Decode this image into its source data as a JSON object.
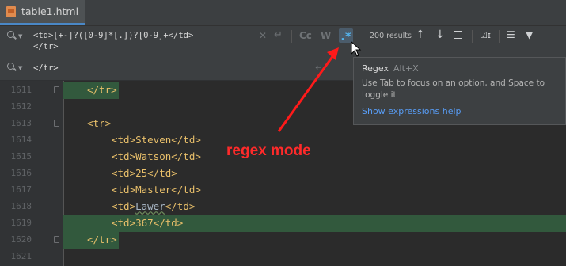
{
  "tab": {
    "label": "table1.html",
    "icon": "html-file-icon"
  },
  "find": {
    "query_lines": [
      "<td>[+-]?([0-9]*[.])?[0-9]+</td>",
      "</tr>"
    ],
    "replace_query": "</tr>",
    "match_case_label": "Cc",
    "words_label": "W",
    "regex_glyph": ".*",
    "results": "200 results"
  },
  "tooltip": {
    "title": "Regex",
    "shortcut": "Alt+X",
    "description": "Use Tab to focus on an option, and Space to toggle it",
    "link": "Show expressions help"
  },
  "annotation": {
    "text": "regex mode",
    "color": "#ff2a2a"
  },
  "editor": {
    "lines": [
      {
        "num": "1611",
        "text": "</tr>"
      },
      {
        "num": "1612",
        "text": ""
      },
      {
        "num": "1613",
        "text": "<tr>"
      },
      {
        "num": "1614",
        "text": "<td>Steven</td>"
      },
      {
        "num": "1615",
        "text": "<td>Watson</td>"
      },
      {
        "num": "1616",
        "text": "<td>25</td>"
      },
      {
        "num": "1617",
        "text": "<td>Master</td>"
      },
      {
        "num": "1618",
        "open": "<td>",
        "word": "Lawer",
        "close": "</td>"
      },
      {
        "num": "1619",
        "text": "<td>367</td>"
      },
      {
        "num": "1620",
        "text": "</tr>"
      },
      {
        "num": "1621",
        "text": ""
      }
    ]
  },
  "colors": {
    "background": "#2b2b2b",
    "match_highlight": "#32593d",
    "tag": "#e8bf6a",
    "link": "#589df6"
  }
}
